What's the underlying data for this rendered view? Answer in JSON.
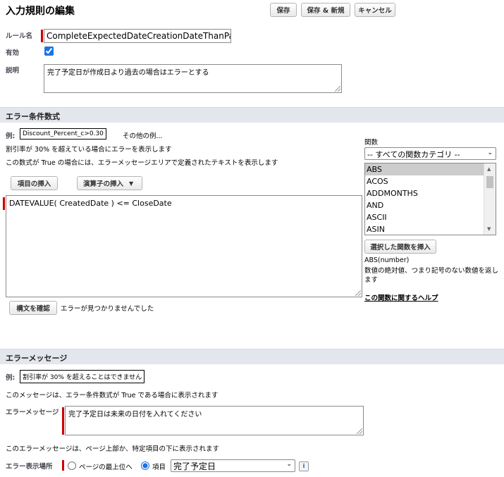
{
  "header": {
    "title": "入力規則の編集",
    "save_label": "保存",
    "save_new_label": "保存 & 新規",
    "cancel_label": "キャンセル"
  },
  "rule": {
    "name_label": "ルール名",
    "name_value": "CompleteExpectedDateCreationDateThanPast",
    "active_label": "有効",
    "active_checked": true,
    "description_label": "説明",
    "description_value": "完了予定日が作成日より過去の場合はエラーとする"
  },
  "formula_section": {
    "title": "エラー条件数式",
    "example_label": "例:",
    "example_value": "Discount_Percent_c>0.30",
    "more_examples": "その他の例...",
    "example_desc": "割引率が 30% を超えている場合にエラーを表示します",
    "formula_desc": "この数式が True の場合には、エラーメッセージエリアで定義されたテキストを表示します",
    "insert_field_label": "項目の挿入",
    "insert_operator_label": "演算子の挿入",
    "formula_value": "DATEVALUE( CreatedDate ) <= CloseDate",
    "check_syntax_label": "構文を確認",
    "syntax_result": "エラーが見つかりませんでした"
  },
  "functions": {
    "label": "関数",
    "category_selected": "-- すべての関数カテゴリ --",
    "items": [
      "ABS",
      "ACOS",
      "ADDMONTHS",
      "AND",
      "ASCII",
      "ASIN"
    ],
    "selected": "ABS",
    "insert_label": "選択した関数を挿入",
    "signature": "ABS(number)",
    "description": "数値の絶対値、つまり記号のない数値を返します",
    "help_link": "この関数に関するヘルプ"
  },
  "message_section": {
    "title": "エラーメッセージ",
    "example_label": "例:",
    "example_value": "割引率が 30% を超えることはできません",
    "display_desc": "このメッセージは、エラー条件数式が True である場合に表示されます",
    "message_label": "エラーメッセージ",
    "message_value": "完了予定日は未来の日付を入れてください",
    "location_desc": "このエラーメッセージは、ページ上部か、特定項目の下に表示されます",
    "location_label": "エラー表示場所",
    "option_top": "ページの最上位へ",
    "option_field": "項目",
    "field_selected": "完了予定日",
    "info_icon": "i"
  }
}
